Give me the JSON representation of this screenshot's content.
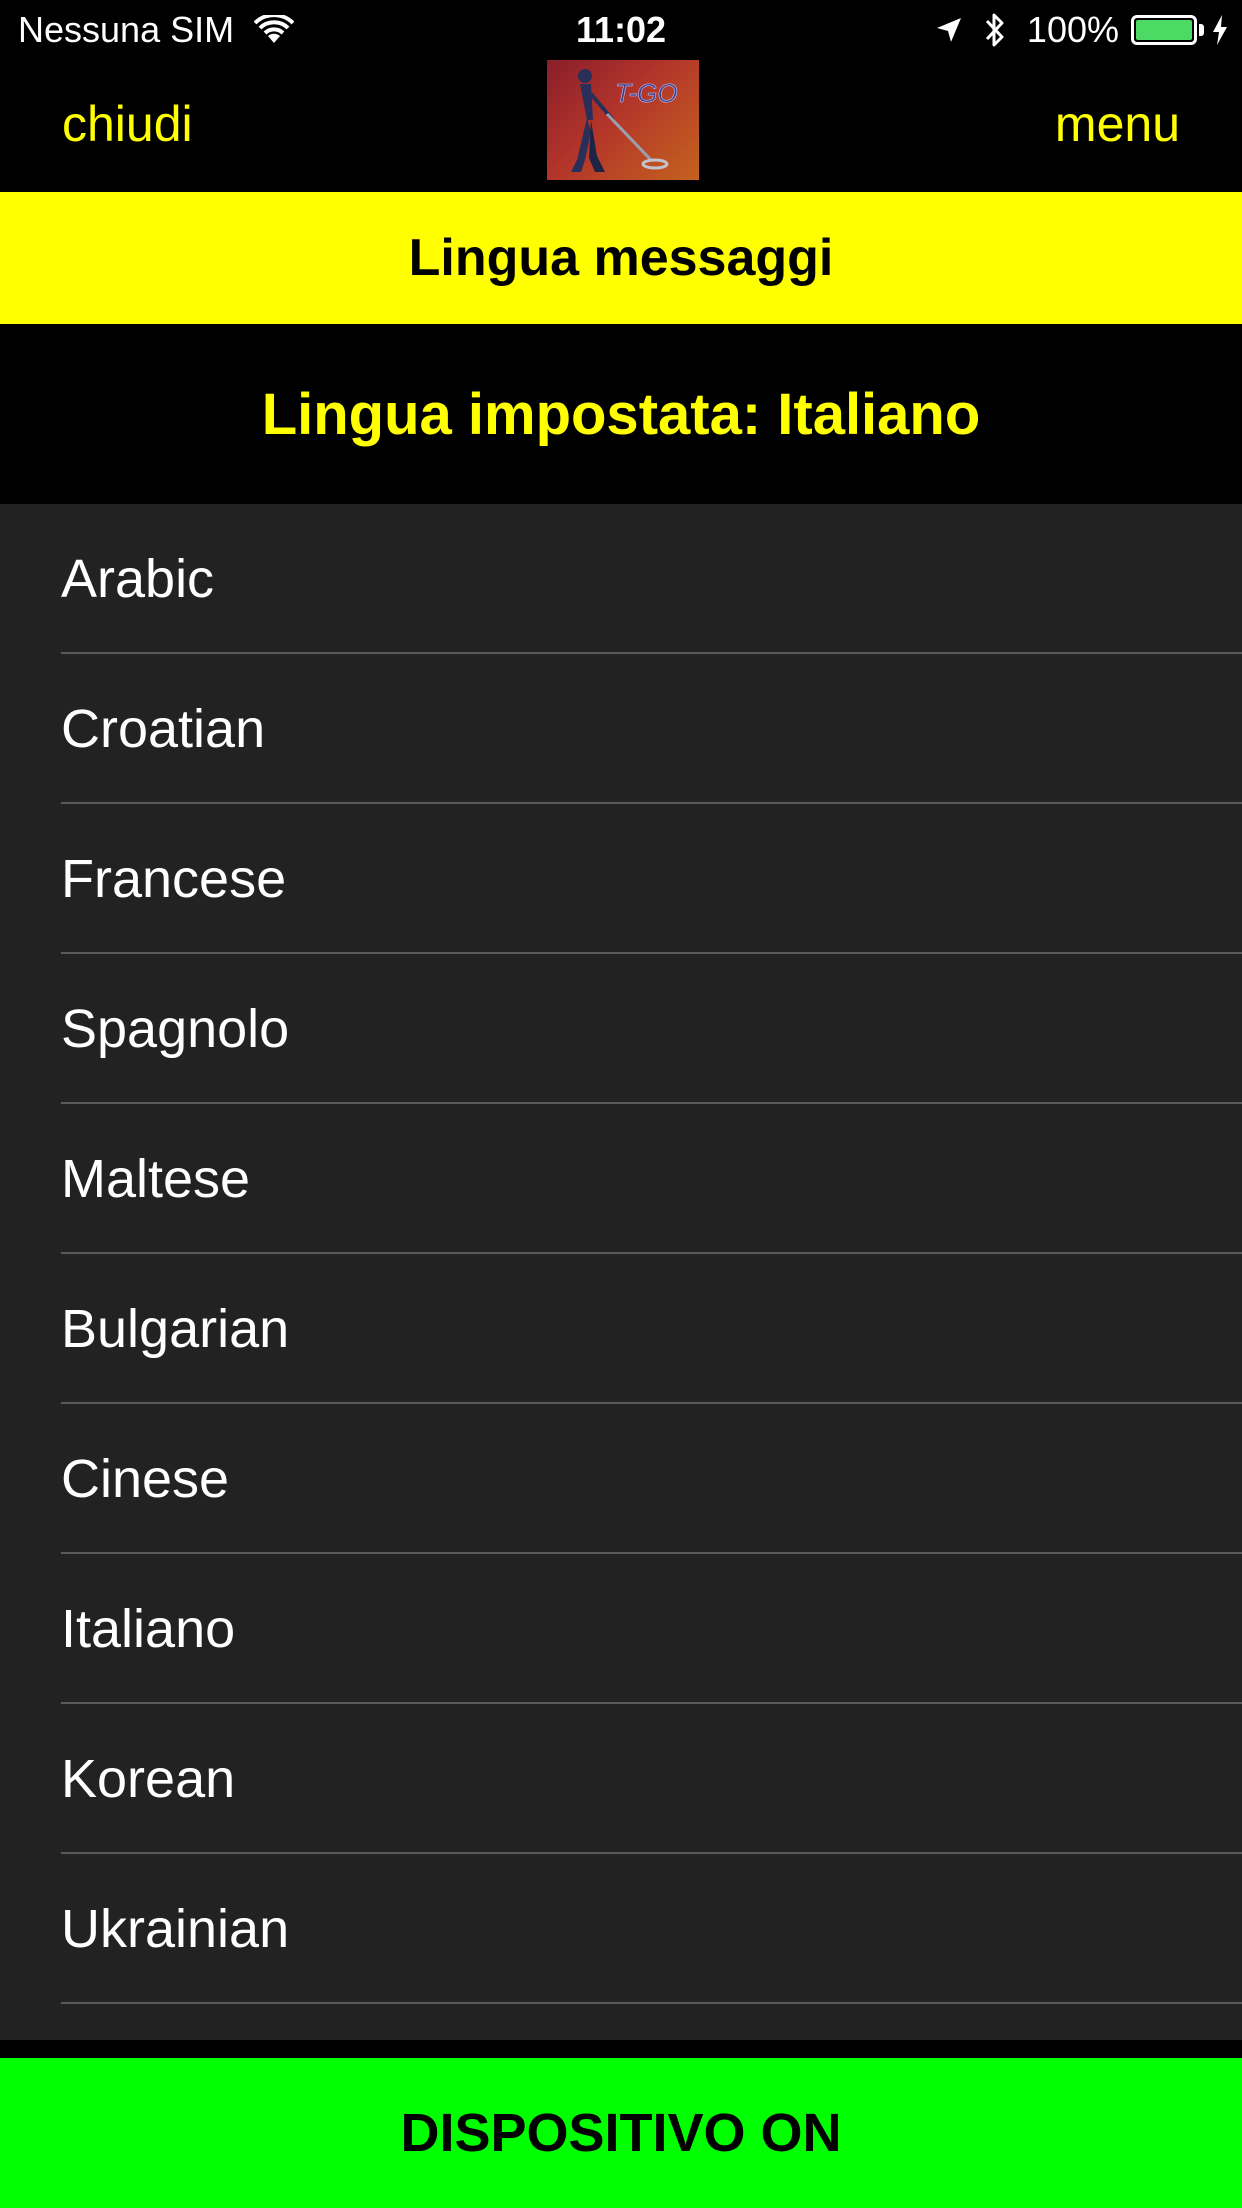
{
  "status_bar": {
    "carrier": "Nessuna SIM",
    "time": "11:02",
    "battery_percent": "100%",
    "battery_level": 1.0,
    "icons": [
      "wifi-icon",
      "location-arrow-icon",
      "bluetooth-icon",
      "battery-icon",
      "charging-bolt-icon"
    ]
  },
  "nav": {
    "left_label": "chiudi",
    "right_label": "menu",
    "logo_text": "T-GO"
  },
  "title": "Lingua messaggi",
  "current_language": "Lingua impostata: Italiano",
  "languages": [
    {
      "label": "Arabic"
    },
    {
      "label": "Croatian"
    },
    {
      "label": "Francese"
    },
    {
      "label": "Spagnolo"
    },
    {
      "label": "Maltese"
    },
    {
      "label": "Bulgarian"
    },
    {
      "label": "Cinese"
    },
    {
      "label": "Italiano"
    },
    {
      "label": "Korean"
    },
    {
      "label": "Ukrainian"
    }
  ],
  "footer": {
    "device_status": "DISPOSITIVO ON"
  },
  "colors": {
    "accent_yellow": "#ffff00",
    "status_green": "#00ff00",
    "list_background": "#222222",
    "battery_green": "#4cd964"
  }
}
